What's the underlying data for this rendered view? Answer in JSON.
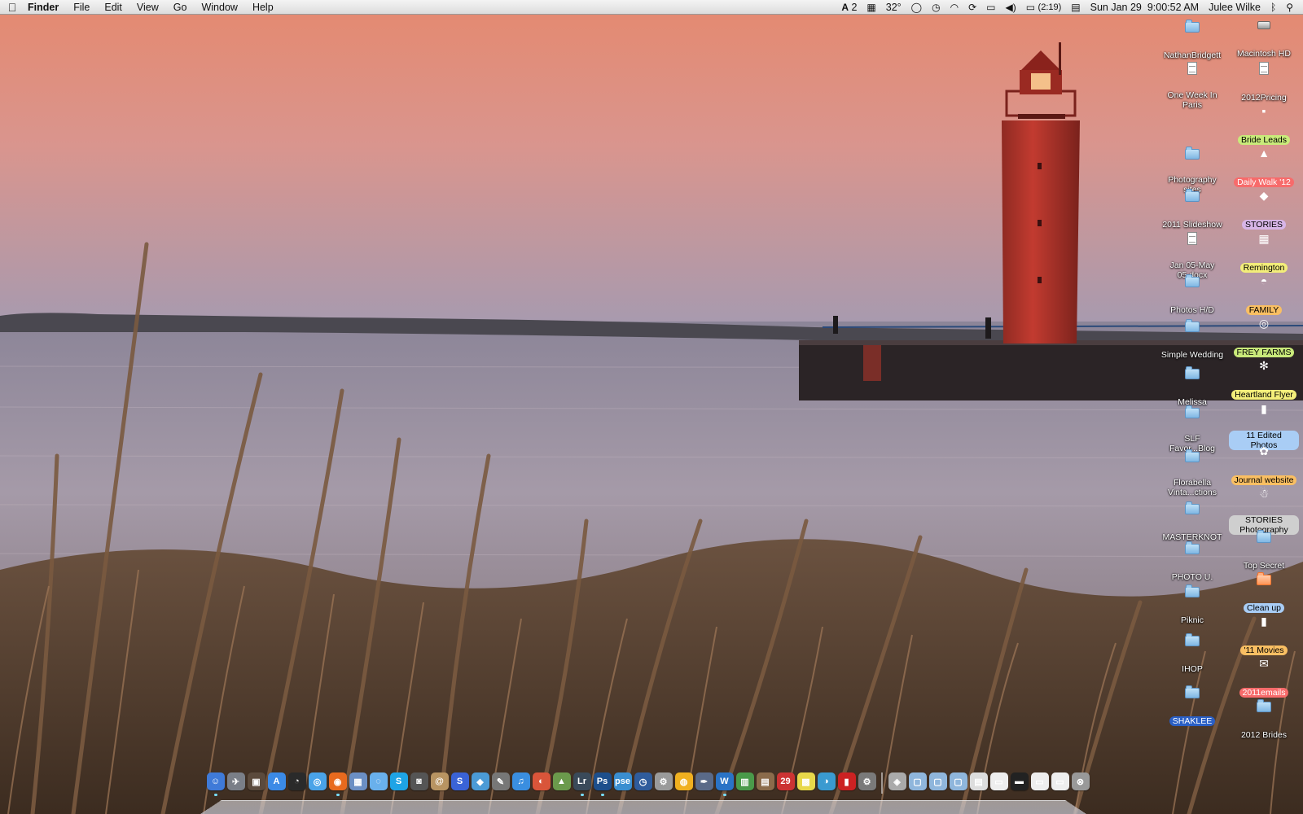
{
  "menubar": {
    "apple_icon": "apple-logo-icon",
    "menus": [
      "Finder",
      "File",
      "Edit",
      "View",
      "Go",
      "Window",
      "Help"
    ],
    "extras": {
      "adobe": "2",
      "temperature": "32°",
      "battery_time": "(2:19)",
      "datetime": "Sun Jan 29  9:00:52 AM",
      "user": "Julee Wilke"
    }
  },
  "desktop": {
    "left_column": [
      {
        "label": "NathanBridgett",
        "kind": "folder"
      },
      {
        "label": "One Week In Paris",
        "kind": "doc"
      },
      {
        "label": "Photography sites",
        "kind": "folder"
      },
      {
        "label": "2011 Slideshow",
        "kind": "folder"
      },
      {
        "label": "Jan 05-May 05.docx",
        "kind": "doc"
      },
      {
        "label": "Photos H/D",
        "kind": "folder"
      },
      {
        "label": "Simple Wedding",
        "kind": "folder"
      },
      {
        "label": "Melissa",
        "kind": "folder"
      },
      {
        "label": "SLF Favor...Blog",
        "kind": "folder"
      },
      {
        "label": "Florabella Vinta...ctions",
        "kind": "folder"
      },
      {
        "label": "MASTERKNOT",
        "kind": "folder"
      },
      {
        "label": "PHOTO U.",
        "kind": "folder"
      },
      {
        "label": "Piknic",
        "kind": "folder"
      },
      {
        "label": "IHOP",
        "kind": "folder"
      },
      {
        "label": "SHAKLEE",
        "kind": "folder",
        "selected": true
      }
    ],
    "right_column": [
      {
        "label": "Macintosh HD",
        "kind": "disk"
      },
      {
        "label": "2012Pricing",
        "kind": "doc"
      },
      {
        "label": "Bride Leads",
        "kind": "sticky",
        "tag": "green"
      },
      {
        "label": "Daily Walk '12",
        "kind": "tree",
        "tag": "red"
      },
      {
        "label": "STORIES",
        "kind": "purple",
        "tag": "purple"
      },
      {
        "label": "Remington",
        "kind": "calc",
        "tag": "yellow"
      },
      {
        "label": "FAMILY",
        "kind": "umbrella",
        "tag": "orange"
      },
      {
        "label": "FREY FARMS",
        "kind": "wreath",
        "tag": "green"
      },
      {
        "label": "Heartland Flyer",
        "kind": "snowflake",
        "tag": "yellow"
      },
      {
        "label": "11 Edited Photos",
        "kind": "bottle",
        "tag": "blue"
      },
      {
        "label": "Journal website",
        "kind": "flower",
        "tag": "orange"
      },
      {
        "label": "STORIES Photography",
        "kind": "snowman",
        "tag": "gray"
      },
      {
        "label": "Top Secret",
        "kind": "folder"
      },
      {
        "label": "Clean up",
        "kind": "folder-yellow",
        "tag": "blue"
      },
      {
        "label": "'11 Movies",
        "kind": "film",
        "tag": "orange"
      },
      {
        "label": "2011emails",
        "kind": "mail",
        "tag": "red"
      },
      {
        "label": "2012 Brides",
        "kind": "folder"
      }
    ]
  },
  "dock": {
    "apps": [
      {
        "name": "Finder",
        "glyph": "☺",
        "color": "#3f7ad8",
        "running": true
      },
      {
        "name": "Launchpad",
        "glyph": "✈",
        "color": "#7a7f88"
      },
      {
        "name": "Photo Booth",
        "glyph": "▣",
        "color": "#5b4a3c"
      },
      {
        "name": "App Store",
        "glyph": "A",
        "color": "#3b8ae6"
      },
      {
        "name": "Dashboard",
        "glyph": "◔",
        "color": "#2a2a2a"
      },
      {
        "name": "Safari",
        "glyph": "◎",
        "color": "#4aa3e8"
      },
      {
        "name": "Firefox",
        "glyph": "◉",
        "color": "#e86a1e",
        "running": true
      },
      {
        "name": "Preview",
        "glyph": "▦",
        "color": "#6b8fc4"
      },
      {
        "name": "iChat",
        "glyph": "◌",
        "color": "#69b0ec"
      },
      {
        "name": "Skype",
        "glyph": "S",
        "color": "#1ea4e6"
      },
      {
        "name": "FaceTime",
        "glyph": "◙",
        "color": "#555"
      },
      {
        "name": "Address Book",
        "glyph": "@",
        "color": "#b89462"
      },
      {
        "name": "Evernote",
        "glyph": "S",
        "color": "#3a63d6"
      },
      {
        "name": "Dropbox",
        "glyph": "◆",
        "color": "#4b9bd6"
      },
      {
        "name": "Script Editor",
        "glyph": "✎",
        "color": "#777"
      },
      {
        "name": "iTunes",
        "glyph": "♫",
        "color": "#3a8ee0"
      },
      {
        "name": "Picasa",
        "glyph": "◐",
        "color": "#d9553a"
      },
      {
        "name": "iPhoto",
        "glyph": "▲",
        "color": "#6b9a4c"
      },
      {
        "name": "Lightroom",
        "glyph": "Lr",
        "color": "#3a4a5a",
        "running": true
      },
      {
        "name": "Photoshop",
        "glyph": "Ps",
        "color": "#1d4f8c",
        "running": true
      },
      {
        "name": "Photoshop Elements",
        "glyph": "pse",
        "color": "#3a8ed0"
      },
      {
        "name": "Time Machine",
        "glyph": "◷",
        "color": "#2f5c9c"
      },
      {
        "name": "Automator",
        "glyph": "⚙",
        "color": "#9a9a9a"
      },
      {
        "name": "Growl",
        "glyph": "◍",
        "color": "#f0b020"
      },
      {
        "name": "Pages",
        "glyph": "✒",
        "color": "#5a6a88"
      },
      {
        "name": "Word",
        "glyph": "W",
        "color": "#2a73c6",
        "running": true
      },
      {
        "name": "Numbers",
        "glyph": "▥",
        "color": "#4a9a4a"
      },
      {
        "name": "Keynote",
        "glyph": "▤",
        "color": "#8b6b4b"
      },
      {
        "name": "iCal",
        "glyph": "29",
        "color": "#c33"
      },
      {
        "name": "Stickies",
        "glyph": "▩",
        "color": "#e8d84a"
      },
      {
        "name": "Network",
        "glyph": "◑",
        "color": "#3a9ad0"
      },
      {
        "name": "Flip",
        "glyph": "▮",
        "color": "#c22"
      },
      {
        "name": "System Preferences",
        "glyph": "⚙",
        "color": "#7a7a7a"
      }
    ],
    "stacks": [
      {
        "name": "Utilities",
        "glyph": "◈",
        "color": "#aaa"
      },
      {
        "name": "Applications",
        "glyph": "▢",
        "color": "#8fb6dc"
      },
      {
        "name": "Documents",
        "glyph": "▢",
        "color": "#8fb6dc"
      },
      {
        "name": "Downloads",
        "glyph": "▢",
        "color": "#8fb6dc"
      },
      {
        "name": "Doc 1",
        "glyph": "▤",
        "color": "#ddd"
      },
      {
        "name": "Window 1",
        "glyph": "▭",
        "color": "#eee"
      },
      {
        "name": "Window 2",
        "glyph": "▬",
        "color": "#222"
      },
      {
        "name": "Window 3",
        "glyph": "▭",
        "color": "#eee"
      },
      {
        "name": "Window 4",
        "glyph": "▭",
        "color": "#eee"
      },
      {
        "name": "Trash",
        "glyph": "⊗",
        "color": "#999"
      }
    ]
  },
  "colors": {
    "sky_top": "#e9917a",
    "sky_bottom": "#a98fa6",
    "lighthouse_red": "#c0362c",
    "water": "#8e8599"
  }
}
